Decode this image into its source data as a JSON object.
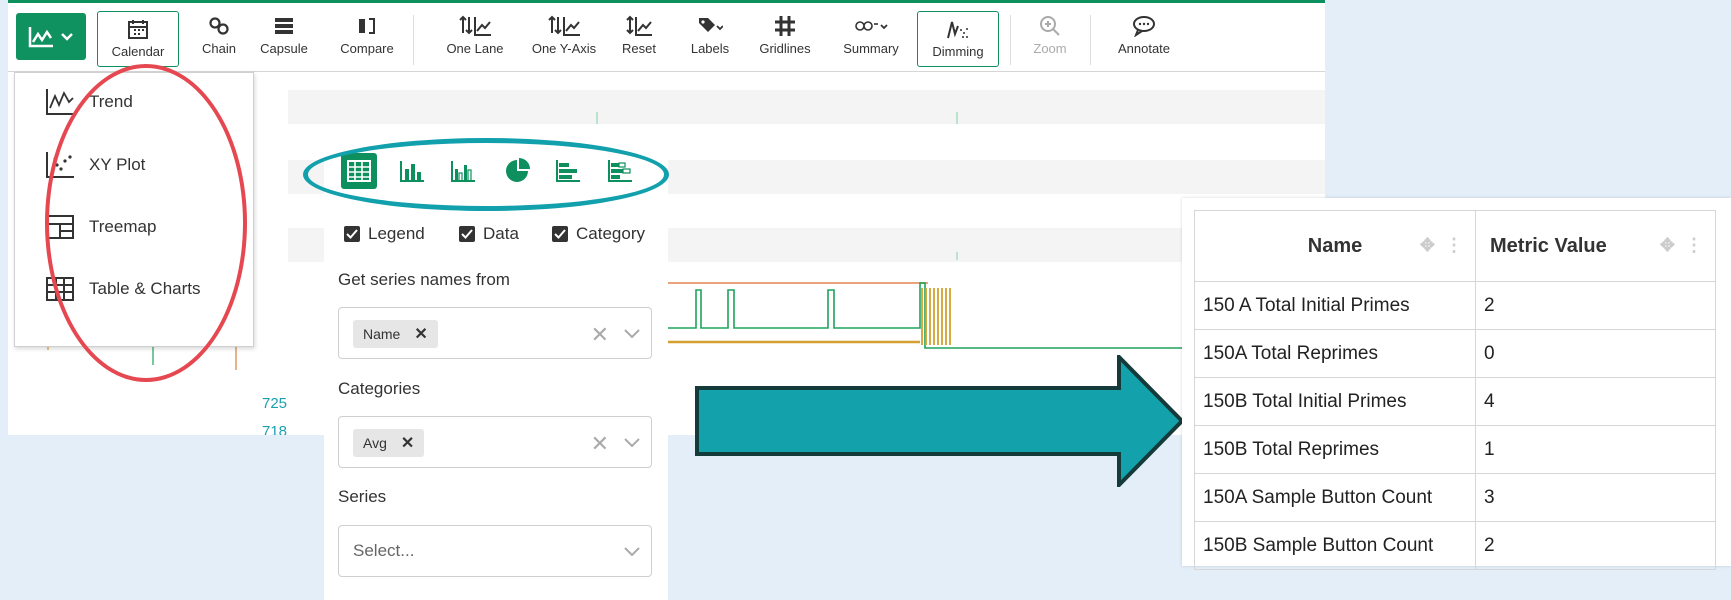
{
  "toolbar": {
    "view_button_icon": "line-chart-icon",
    "buttons": [
      {
        "label": "Calendar",
        "icon": "calendar-icon"
      },
      {
        "label": "Chain",
        "icon": "chain-icon"
      },
      {
        "label": "Capsule",
        "icon": "capsule-icon"
      },
      {
        "label": "Compare",
        "icon": "compare-icon"
      },
      {
        "label": "One Lane",
        "icon": "one-lane-icon"
      },
      {
        "label": "One Y-Axis",
        "icon": "one-y-axis-icon"
      },
      {
        "label": "Reset",
        "icon": "reset-icon"
      },
      {
        "label": "Labels",
        "icon": "tag-icon"
      },
      {
        "label": "Gridlines",
        "icon": "grid-icon"
      },
      {
        "label": "Summary",
        "icon": "summary-icon"
      },
      {
        "label": "Dimming",
        "icon": "dimming-icon"
      },
      {
        "label": "Zoom",
        "icon": "zoom-icon"
      },
      {
        "label": "Annotate",
        "icon": "comment-icon"
      }
    ]
  },
  "view_menu": {
    "items": [
      {
        "label": "Trend",
        "icon": "trend-icon"
      },
      {
        "label": "XY Plot",
        "icon": "scatter-icon"
      },
      {
        "label": "Treemap",
        "icon": "treemap-icon"
      },
      {
        "label": "Table & Charts",
        "icon": "table-icon"
      }
    ]
  },
  "chart_panel": {
    "chart_types": [
      "table-icon",
      "bar-chart-icon",
      "grouped-bar-icon",
      "pie-chart-icon",
      "horizontal-bar-icon",
      "stacked-horizontal-bar-icon"
    ],
    "checkboxes": {
      "legend": "Legend",
      "data": "Data",
      "category": "Category"
    },
    "series_names_label": "Get series names from",
    "series_names_tag": "Name",
    "categories_label": "Categories",
    "categories_tag": "Avg",
    "series_label": "Series",
    "series_placeholder": "Select..."
  },
  "axis_ticks": {
    "t1": "725",
    "t2": "718"
  },
  "table": {
    "headers": {
      "name": "Name",
      "value": "Metric Value"
    },
    "rows": [
      {
        "name": "150 A Total Initial Primes",
        "value": "2"
      },
      {
        "name": "150A Total Reprimes",
        "value": "0"
      },
      {
        "name": "150B Total Initial Primes",
        "value": "4"
      },
      {
        "name": "150B Total Reprimes",
        "value": "1"
      },
      {
        "name": "150A Sample Button Count",
        "value": "3"
      },
      {
        "name": "150B Sample Button Count",
        "value": "2"
      }
    ]
  },
  "colors": {
    "brand_green": "#0e8f5e",
    "highlight_teal": "#12a0ad",
    "highlight_red": "#e54850"
  }
}
